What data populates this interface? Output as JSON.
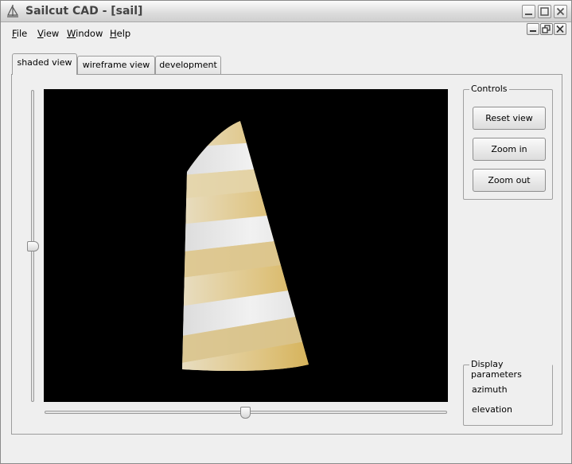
{
  "window": {
    "title": "Sailcut CAD - [sail]"
  },
  "menu": [
    {
      "accel": "F",
      "rest": "ile"
    },
    {
      "accel": "V",
      "rest": "iew"
    },
    {
      "accel": "W",
      "rest": "indow"
    },
    {
      "accel": "H",
      "rest": "elp"
    }
  ],
  "tabs": [
    "shaded view",
    "wireframe view",
    "development"
  ],
  "controls": {
    "title": "Controls",
    "reset_label": "Reset view",
    "zoom_in_label": "Zoom in",
    "zoom_out_label": "Zoom out"
  },
  "display_parameters": {
    "title": "Display parameters",
    "azimuth_label": "azimuth",
    "elevation_label": "elevation"
  },
  "sliders": {
    "elevation_fraction": 0.5,
    "azimuth_fraction": 0.5
  },
  "sail_colors": {
    "gold": "#d8b458",
    "white": "#e8e8e8",
    "viewport_background": "#000000"
  }
}
